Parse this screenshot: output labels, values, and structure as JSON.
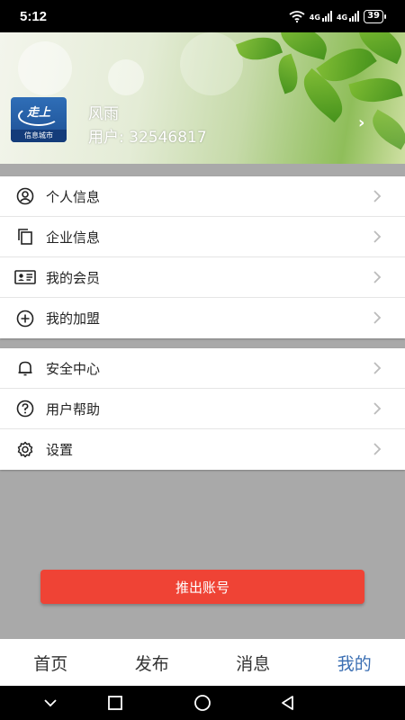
{
  "status_bar": {
    "time": "5:12",
    "signal_1_label": "4G",
    "signal_2_label": "4G",
    "battery": "39"
  },
  "profile": {
    "logo_top_text": "走上",
    "logo_bottom_text": "信息城市",
    "name": "风雨",
    "user_id": "用户: 32546817"
  },
  "menu_group_1": [
    {
      "label": "个人信息",
      "icon": "person-circle-icon"
    },
    {
      "label": "企业信息",
      "icon": "copy-icon"
    },
    {
      "label": "我的会员",
      "icon": "id-card-icon"
    },
    {
      "label": "我的加盟",
      "icon": "plus-circle-icon"
    }
  ],
  "menu_group_2": [
    {
      "label": "安全中心",
      "icon": "bell-icon"
    },
    {
      "label": "用户帮助",
      "icon": "help-circle-icon"
    },
    {
      "label": "设置",
      "icon": "gear-icon"
    }
  ],
  "logout_label": "推出账号",
  "bottom_nav": [
    {
      "label": "首页",
      "active": false
    },
    {
      "label": "发布",
      "active": false
    },
    {
      "label": "消息",
      "active": false
    },
    {
      "label": "我的",
      "active": true
    }
  ],
  "colors": {
    "accent": "#3b6fb3",
    "logout": "#ef4335",
    "page_bg": "#a9a9a9"
  }
}
